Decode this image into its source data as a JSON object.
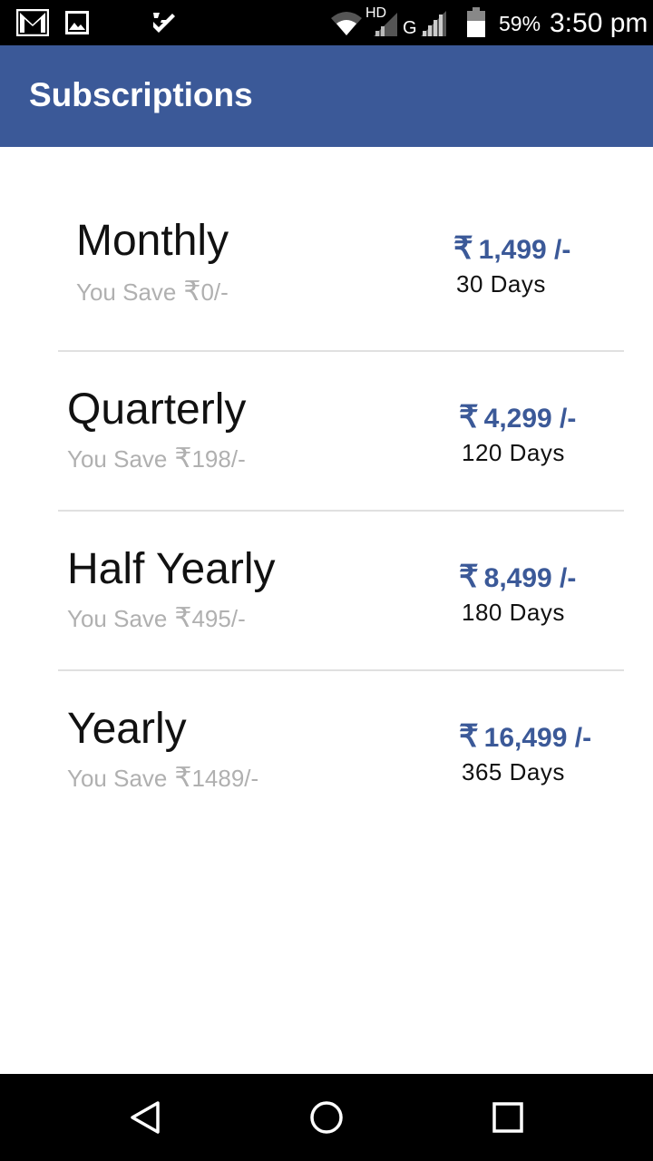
{
  "status_bar": {
    "network_hd": "HD",
    "network_type": "G",
    "battery_percent": "59%",
    "time": "3:50 pm",
    "icons": [
      "gmail-icon",
      "gallery-icon",
      "tasks-check-icon",
      "wifi-icon",
      "signal-icon",
      "signal-icon",
      "battery-icon"
    ]
  },
  "app_bar": {
    "title": "Subscriptions",
    "color": "#3b5998"
  },
  "currency_symbol": "₹",
  "plans": [
    {
      "name": "Monthly",
      "save_label": "You Save",
      "save_amount": "0/-",
      "price": "1,499 /-",
      "days": "30 Days"
    },
    {
      "name": "Quarterly",
      "save_label": "You Save",
      "save_amount": "198/-",
      "price": "4,299 /-",
      "days": "120 Days"
    },
    {
      "name": "Half Yearly",
      "save_label": "You Save",
      "save_amount": "495/-",
      "price": "8,499 /-",
      "days": "180 Days"
    },
    {
      "name": "Yearly",
      "save_label": "You Save",
      "save_amount": "1489/-",
      "price": "16,499 /-",
      "days": "365 Days"
    }
  ],
  "nav_bar": {
    "buttons": [
      "back-icon",
      "home-icon",
      "recents-icon"
    ]
  },
  "colors": {
    "accent": "#3b5998",
    "save_text": "#b0b0b0",
    "divider": "#e0e0e0"
  }
}
